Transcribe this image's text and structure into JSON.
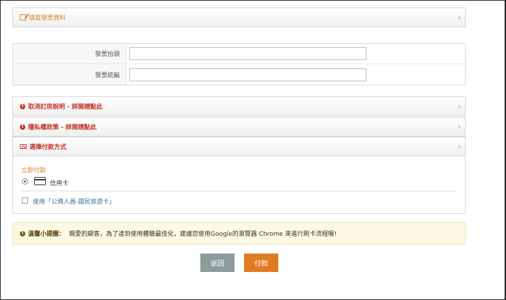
{
  "sections": {
    "fill_invoice": {
      "title": "填寫發票資料",
      "chevron": "›"
    },
    "cancel_booking": {
      "title": "取消訂房說明 - 詳閱請點此",
      "chevron": "›"
    },
    "privacy": {
      "title": "隱私權政策 - 詳閱請點此",
      "chevron": "›"
    },
    "payment_method": {
      "title": "選擇付款方式",
      "chevron": "›"
    }
  },
  "invoice_form": {
    "title_label": "發票抬頭",
    "title_value": "",
    "tax_id_label": "發票統編",
    "tax_id_value": ""
  },
  "payment": {
    "pay_now_label": "立即付款",
    "credit_card_label": "信用卡",
    "credit_card_selected": true,
    "travel_card_label": "使用「公務人員-國民旅遊卡」",
    "travel_card_checked": false
  },
  "notice": {
    "title": "溫馨小提醒：",
    "text": "親愛的顧客，為了達到使用體驗最佳化，建議您使用Google的瀏覽器 Chrome 來進行刷卡流程喔!"
  },
  "buttons": {
    "back": "返回",
    "pay": "付款"
  },
  "icons": {
    "fill_invoice": "edit-icon",
    "cancel_booking": "exclamation-circle-icon",
    "privacy": "exclamation-circle-icon",
    "payment_method": "money-icon",
    "credit_card": "credit-card-icon",
    "notice": "exclamation-circle-icon"
  },
  "colors": {
    "accent_orange": "#e07b25",
    "section_red": "#c0392b",
    "back_button": "#8c9c9a",
    "notice_bg": "#fcf8e3"
  }
}
